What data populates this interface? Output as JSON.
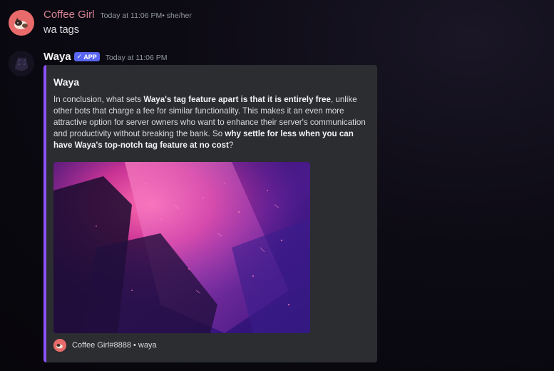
{
  "messages": [
    {
      "author": "Coffee Girl",
      "timestamp": "Today at 11:06 PM",
      "pronouns": " • she/her",
      "content": "wa tags",
      "avatar_icon": "cat-avatar-icon"
    },
    {
      "author": "Waya",
      "badge": "APP",
      "badge_icon": "checkmark-icon",
      "timestamp": "Today at 11:06 PM",
      "avatar_icon": "dark-avatar-icon",
      "embed": {
        "accent_color": "#8c52ff",
        "title": "Waya",
        "description_parts": [
          "In conclusion, what sets ",
          "Waya's tag feature apart is that it is entirely free",
          ", unlike other bots that charge a fee for similar functionality. This makes it an even more attractive option for server owners who want to enhance their server's communication and productivity without breaking the bank. So ",
          "why settle for less when you can have Waya's top-notch tag feature at no cost",
          "?"
        ],
        "image_icon": "purple-abstract-image",
        "footer_text": "Coffee Girl#8888 • waya"
      }
    }
  ],
  "colors": {
    "coffee_name": "#d88496",
    "app_badge": "#5865f2",
    "embed_bg": "#2b2d31"
  }
}
